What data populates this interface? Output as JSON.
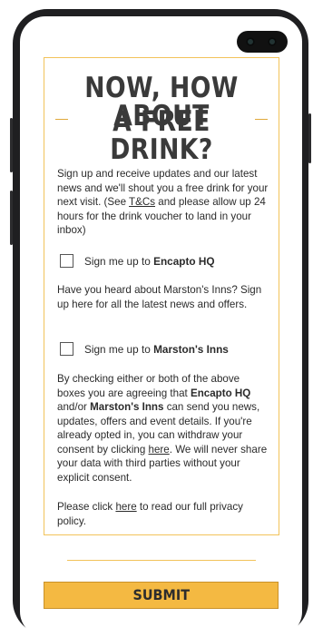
{
  "card": {
    "title_line1": "NOW, HOW ABOUT",
    "title_line2": "A FREE DRINK?",
    "intro": {
      "before": "Sign up and receive updates and our latest news and we'll shout you a free drink for your next visit. (See ",
      "tcs_link": "T&Cs",
      "after": " and please allow up 24 hours for the drink voucher to land in your inbox)"
    },
    "checkbox1": {
      "prefix": "Sign me up to ",
      "brand": "Encapto HQ"
    },
    "marstons_text": "Have you heard about Marston's Inns? Sign up here for all the latest news and offers.",
    "checkbox2": {
      "prefix": "Sign me up to ",
      "brand": "Marston's Inns"
    },
    "consent": {
      "p1": "By checking either or both of the above boxes you are agreeing that ",
      "brand1": "Encapto HQ",
      "p2": " and/or ",
      "brand2": "Marston's Inns",
      "p3": " can send you news, updates, offers and event details. If you're already opted in, you can withdraw your consent by clicking ",
      "link": "here",
      "p4": ". We will never share your data with third parties without your explicit consent."
    },
    "privacy": {
      "before": "Please click ",
      "link": "here",
      "after": " to read our full privacy policy."
    }
  },
  "submit_label": "SUBMIT",
  "colors": {
    "accent": "#f4b942",
    "border": "#f2c35a",
    "text": "#2b2b2b"
  }
}
